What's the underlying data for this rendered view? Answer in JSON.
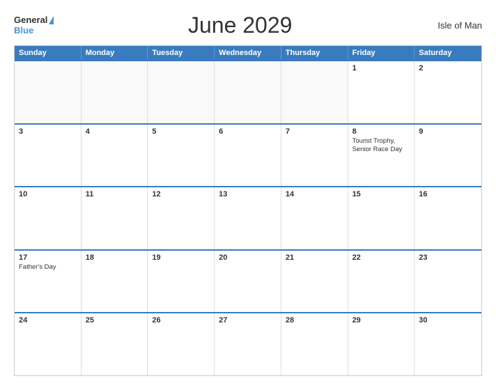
{
  "header": {
    "logo_general": "General",
    "logo_blue": "Blue",
    "title": "June 2029",
    "region": "Isle of Man"
  },
  "calendar": {
    "days_of_week": [
      "Sunday",
      "Monday",
      "Tuesday",
      "Wednesday",
      "Thursday",
      "Friday",
      "Saturday"
    ],
    "weeks": [
      [
        {
          "day": "",
          "empty": true
        },
        {
          "day": "",
          "empty": true
        },
        {
          "day": "",
          "empty": true
        },
        {
          "day": "",
          "empty": true
        },
        {
          "day": "",
          "empty": true
        },
        {
          "day": "1",
          "empty": false,
          "event": ""
        },
        {
          "day": "2",
          "empty": false,
          "event": ""
        }
      ],
      [
        {
          "day": "3",
          "empty": false,
          "event": ""
        },
        {
          "day": "4",
          "empty": false,
          "event": ""
        },
        {
          "day": "5",
          "empty": false,
          "event": ""
        },
        {
          "day": "6",
          "empty": false,
          "event": ""
        },
        {
          "day": "7",
          "empty": false,
          "event": ""
        },
        {
          "day": "8",
          "empty": false,
          "event": "Tourist Trophy, Senior Race Day"
        },
        {
          "day": "9",
          "empty": false,
          "event": ""
        }
      ],
      [
        {
          "day": "10",
          "empty": false,
          "event": ""
        },
        {
          "day": "11",
          "empty": false,
          "event": ""
        },
        {
          "day": "12",
          "empty": false,
          "event": ""
        },
        {
          "day": "13",
          "empty": false,
          "event": ""
        },
        {
          "day": "14",
          "empty": false,
          "event": ""
        },
        {
          "day": "15",
          "empty": false,
          "event": ""
        },
        {
          "day": "16",
          "empty": false,
          "event": ""
        }
      ],
      [
        {
          "day": "17",
          "empty": false,
          "event": "Father's Day"
        },
        {
          "day": "18",
          "empty": false,
          "event": ""
        },
        {
          "day": "19",
          "empty": false,
          "event": ""
        },
        {
          "day": "20",
          "empty": false,
          "event": ""
        },
        {
          "day": "21",
          "empty": false,
          "event": ""
        },
        {
          "day": "22",
          "empty": false,
          "event": ""
        },
        {
          "day": "23",
          "empty": false,
          "event": ""
        }
      ],
      [
        {
          "day": "24",
          "empty": false,
          "event": ""
        },
        {
          "day": "25",
          "empty": false,
          "event": ""
        },
        {
          "day": "26",
          "empty": false,
          "event": ""
        },
        {
          "day": "27",
          "empty": false,
          "event": ""
        },
        {
          "day": "28",
          "empty": false,
          "event": ""
        },
        {
          "day": "29",
          "empty": false,
          "event": ""
        },
        {
          "day": "30",
          "empty": false,
          "event": ""
        }
      ]
    ]
  }
}
